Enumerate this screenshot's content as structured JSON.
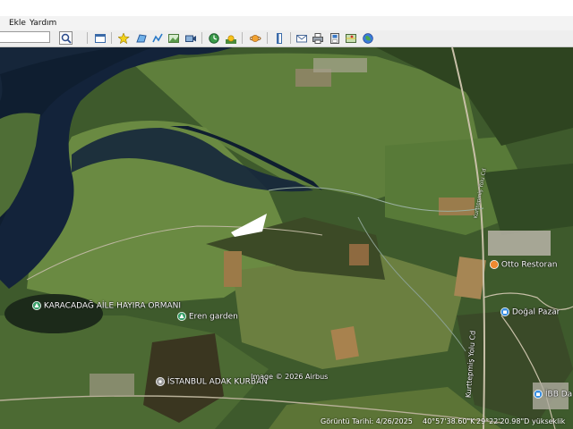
{
  "menu": {
    "items": [
      "Ekle",
      "Yardım"
    ]
  },
  "search": {
    "placeholder": ""
  },
  "map": {
    "places": [
      {
        "label": "KARACADAĞ AİLE HAYIRA ORMANI",
        "icon": "park-pin-icon",
        "color": "#3aa06a"
      },
      {
        "label": "Eren garden",
        "icon": "park-pin-icon",
        "color": "#3aa06a"
      },
      {
        "label": "Otto Restoran",
        "icon": "restaurant-pin-icon",
        "color": "#f08a30"
      },
      {
        "label": "Doğal Pazar",
        "icon": "shopping-pin-icon",
        "color": "#3a8fe0"
      },
      {
        "label": "İSTANBUL ADAK KURBAN",
        "icon": "place-pin-icon",
        "color": "#9a9a9a"
      },
      {
        "label": "İBB Da",
        "icon": "shopping-pin-icon",
        "color": "#3a8fe0"
      }
    ],
    "road_label": "Kurttepmiş Yolu Cd",
    "road_label_north": "Kurttepmiş Yolu Cd",
    "attribution": "Image © 2026 Airbus"
  },
  "status": {
    "date": "Görüntü Tarihi: 4/26/2025",
    "lat": "40°57'38.60\"K",
    "lon": "29°22'20.98\"D",
    "elev": "yükseklik"
  }
}
